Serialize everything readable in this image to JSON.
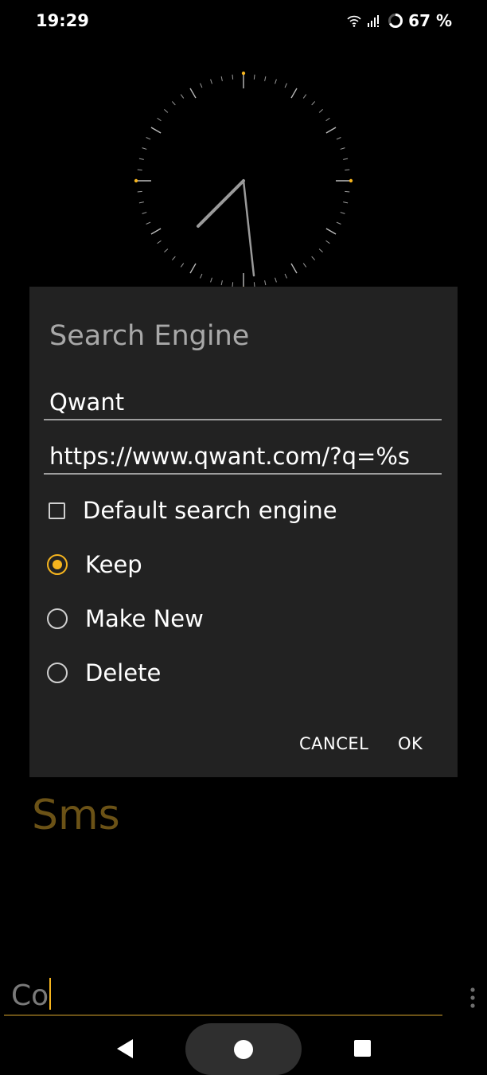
{
  "status_bar": {
    "time": "19:29",
    "battery_percent": "67 %",
    "icons": [
      "wifi-icon",
      "signal-icon",
      "battery-ring-icon"
    ]
  },
  "dialog": {
    "title": "Search Engine",
    "name_value": "Qwant",
    "url_value": "https://www.qwant.com/?q=%s",
    "default_checkbox": {
      "label": "Default search engine",
      "checked": false
    },
    "options": [
      {
        "label": "Keep",
        "selected": true
      },
      {
        "label": "Make New",
        "selected": false
      },
      {
        "label": "Delete",
        "selected": false
      }
    ],
    "cancel_label": "CANCEL",
    "ok_label": "OK"
  },
  "background": {
    "app_label": "Sms"
  },
  "bottom_input": {
    "value": "Co"
  },
  "nav_bar": {
    "icons": [
      "back-icon",
      "home-icon",
      "recents-icon"
    ]
  },
  "colors": {
    "accent": "#f5b41e",
    "dialog_bg": "#222222",
    "muted_accent": "#6b5216",
    "background": "#000000"
  }
}
